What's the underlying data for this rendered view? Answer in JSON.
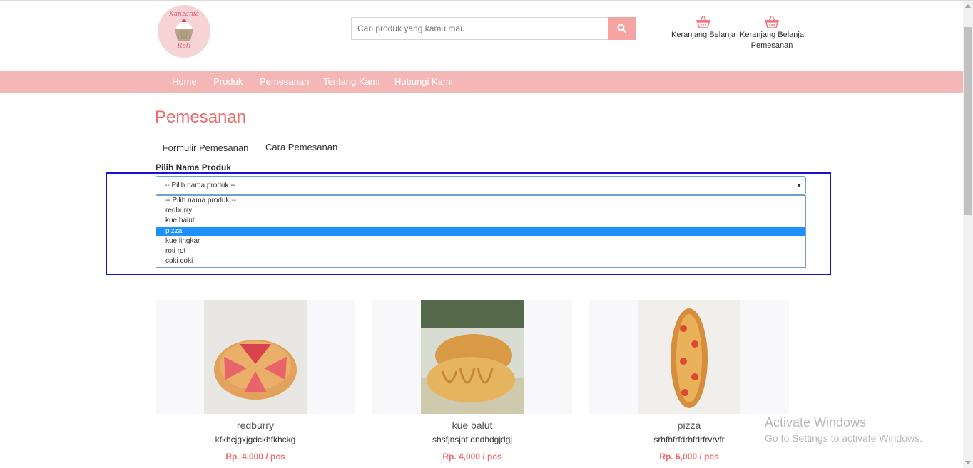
{
  "logo": {
    "top_text": "Kanzania",
    "bottom_text": "Roti"
  },
  "search": {
    "placeholder": "Cari produk yang kamu mau"
  },
  "header": {
    "cart_label": "Keranjang Belanja",
    "order_cart_line1": "Keranjang Belanja",
    "order_cart_line2": "Pemesanan"
  },
  "nav": {
    "items": [
      "Home",
      "Produk",
      "Pemesanan",
      "Tentang Kami",
      "Hubungi Kami"
    ]
  },
  "page": {
    "title": "Pemesanan"
  },
  "tabs": [
    "Formulir Pemesanan",
    "Cara Pemesanan"
  ],
  "form": {
    "label": "Pilih Nama Produk",
    "selected_value": "-- Pilih nama produk --",
    "options": [
      "-- Pilih nama produk --",
      "redburry",
      "kue balut",
      "pizza",
      "kue lingkar",
      "roti rot",
      "coki coki"
    ],
    "highlighted_option": "pizza"
  },
  "products": [
    {
      "name": "redburry",
      "desc": "kfkhcjgxjgdckhfkhckg",
      "price": "Rp. 4,000 / pcs"
    },
    {
      "name": "kue balut",
      "desc": "shsfjnsjnt dndhdgjdgj",
      "price": "Rp. 4,000 / pcs"
    },
    {
      "name": "pizza",
      "desc": "srhfhfrfdrhfdrfrvrvfr",
      "price": "Rp. 6,000 / pcs"
    }
  ],
  "watermark": {
    "line1": "Activate Windows",
    "line2": "Go to Settings to activate Windows."
  },
  "colors": {
    "accent": "#ef6b6b",
    "navbar": "#f5b6b6",
    "selected_option": "#1e90ff",
    "highlight_border": "#1414d4"
  }
}
